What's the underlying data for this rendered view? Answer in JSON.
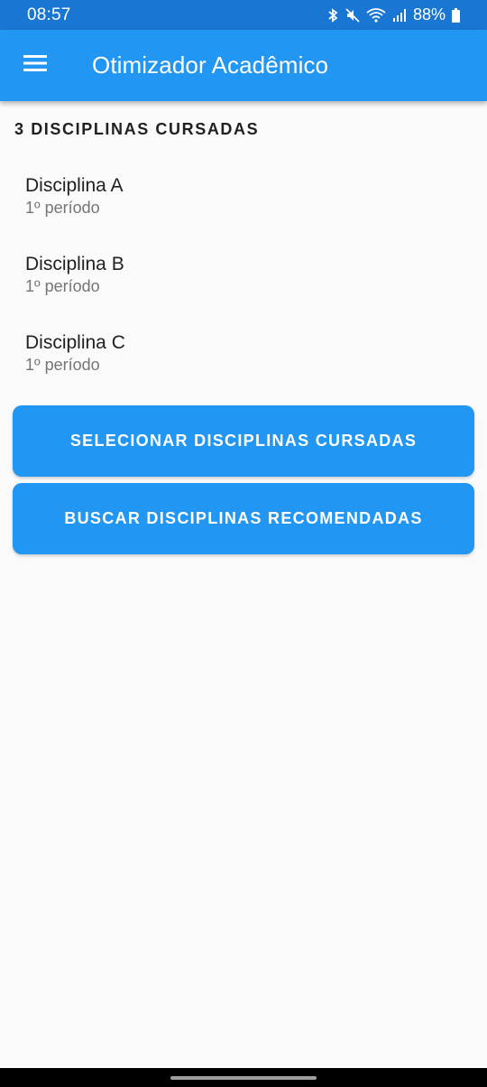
{
  "status_bar": {
    "time": "08:57",
    "battery": "88%",
    "icons": [
      "bluetooth-icon",
      "mute-icon",
      "wifi-icon",
      "signal-icon",
      "battery-icon"
    ]
  },
  "app_bar": {
    "title": "Otimizador Acadêmico",
    "menu_icon": "hamburger-menu-icon",
    "color": "#2196f3"
  },
  "list": {
    "header": "3 DISCIPLINAS CURSADAS",
    "items": [
      {
        "name": "Disciplina A",
        "period": "1º período"
      },
      {
        "name": "Disciplina B",
        "period": "1º período"
      },
      {
        "name": "Disciplina C",
        "period": "1º período"
      }
    ]
  },
  "actions": {
    "select_label": "SELECIONAR DISCIPLINAS CURSADAS",
    "search_label": "BUSCAR DISCIPLINAS RECOMENDADAS"
  },
  "colors": {
    "primary": "#2196f3",
    "status_bar": "#1976d2",
    "background": "#fafafa"
  }
}
